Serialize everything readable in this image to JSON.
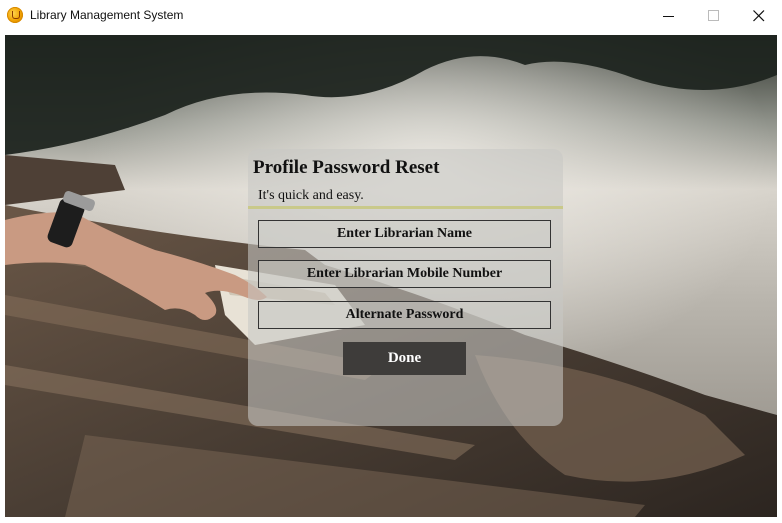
{
  "window": {
    "title": "Library Management System",
    "controls": {
      "minimize": "minimize-icon",
      "maximize": "maximize-icon",
      "close": "close-icon"
    }
  },
  "form": {
    "title": "Profile Password Reset",
    "subtitle": "It's quick and easy.",
    "fields": [
      {
        "placeholder": "Enter Librarian Name"
      },
      {
        "placeholder": "Enter Librarian Mobile Number"
      },
      {
        "placeholder": "Alternate Password"
      }
    ],
    "submit_label": "Done"
  },
  "colors": {
    "accent_divider": "#c9c98a",
    "button_bg": "#3e3c3a",
    "button_text": "#ffffff"
  }
}
